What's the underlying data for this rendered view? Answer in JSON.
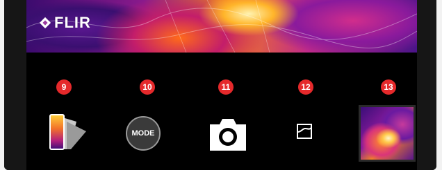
{
  "brand": {
    "name": "FLIR"
  },
  "controls": [
    {
      "number": "9",
      "icon": "palette-icon"
    },
    {
      "number": "10",
      "label": "MODE",
      "icon": "mode-button"
    },
    {
      "number": "11",
      "icon": "camera-icon"
    },
    {
      "number": "12",
      "icon": "image-mode-icon"
    },
    {
      "number": "13",
      "icon": "gallery-thumbnail"
    }
  ],
  "colors": {
    "badge": "#e5292b",
    "screen_background": "#000000"
  }
}
